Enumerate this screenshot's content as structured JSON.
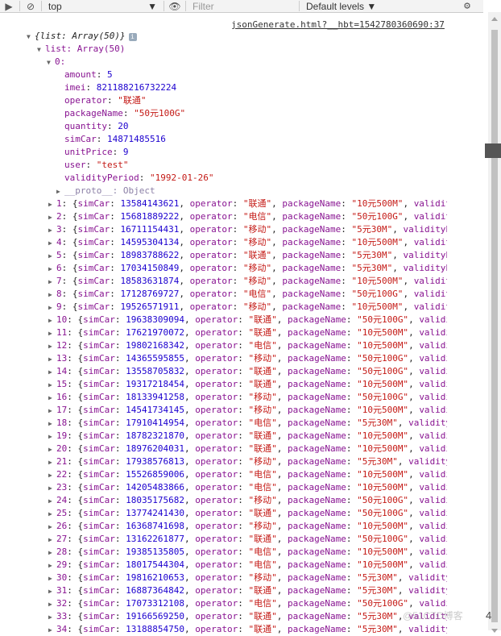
{
  "toolbar": {
    "context": "top",
    "filter_placeholder": "Filter",
    "levels": "Default levels"
  },
  "source_link": "jsonGenerate.html?__hbt=1542780360690:37",
  "root_label": "{list: Array(50)}",
  "list_label": "list: Array(50)",
  "item0": {
    "index": "0",
    "amount": "5",
    "imei": "821188216732224",
    "operator": "\"联通\"",
    "packageName": "\"50元100G\"",
    "quantity": "20",
    "simCar": "14871485516",
    "unitPrice": "9",
    "user": "\"test\"",
    "validityPeriod": "\"1992-01-26\"",
    "proto": "__proto__: Object"
  },
  "rows": [
    {
      "i": "1",
      "sim": "13584143621",
      "op": "\"联通\"",
      "pkg": "\"10元500M\""
    },
    {
      "i": "2",
      "sim": "15681889222",
      "op": "\"电信\"",
      "pkg": "\"50元100G\""
    },
    {
      "i": "3",
      "sim": "16711154431",
      "op": "\"移动\"",
      "pkg": "\"5元30M\""
    },
    {
      "i": "4",
      "sim": "14595304134",
      "op": "\"移动\"",
      "pkg": "\"10元500M\""
    },
    {
      "i": "5",
      "sim": "18983788622",
      "op": "\"联通\"",
      "pkg": "\"5元30M\""
    },
    {
      "i": "6",
      "sim": "17034150849",
      "op": "\"移动\"",
      "pkg": "\"5元30M\""
    },
    {
      "i": "7",
      "sim": "18583631874",
      "op": "\"移动\"",
      "pkg": "\"10元500M\""
    },
    {
      "i": "8",
      "sim": "17128769727",
      "op": "\"电信\"",
      "pkg": "\"50元100G\""
    },
    {
      "i": "9",
      "sim": "19526571911",
      "op": "\"移动\"",
      "pkg": "\"10元500M\""
    },
    {
      "i": "10",
      "sim": "19638309094",
      "op": "\"联通\"",
      "pkg": "\"50元100G\""
    },
    {
      "i": "11",
      "sim": "17621970072",
      "op": "\"联通\"",
      "pkg": "\"10元500M\""
    },
    {
      "i": "12",
      "sim": "19802168342",
      "op": "\"电信\"",
      "pkg": "\"10元500M\""
    },
    {
      "i": "13",
      "sim": "14365595855",
      "op": "\"移动\"",
      "pkg": "\"50元100G\""
    },
    {
      "i": "14",
      "sim": "13558705832",
      "op": "\"联通\"",
      "pkg": "\"50元100G\""
    },
    {
      "i": "15",
      "sim": "19317218454",
      "op": "\"联通\"",
      "pkg": "\"10元500M\""
    },
    {
      "i": "16",
      "sim": "18133941258",
      "op": "\"移动\"",
      "pkg": "\"50元100G\""
    },
    {
      "i": "17",
      "sim": "14541734145",
      "op": "\"移动\"",
      "pkg": "\"10元500M\""
    },
    {
      "i": "18",
      "sim": "17910414954",
      "op": "\"电信\"",
      "pkg": "\"5元30M\""
    },
    {
      "i": "19",
      "sim": "18782321870",
      "op": "\"联通\"",
      "pkg": "\"10元500M\""
    },
    {
      "i": "20",
      "sim": "18976204031",
      "op": "\"联通\"",
      "pkg": "\"10元500M\""
    },
    {
      "i": "21",
      "sim": "17938576813",
      "op": "\"移动\"",
      "pkg": "\"5元30M\""
    },
    {
      "i": "22",
      "sim": "15526859006",
      "op": "\"电信\"",
      "pkg": "\"10元500M\""
    },
    {
      "i": "23",
      "sim": "14205483866",
      "op": "\"电信\"",
      "pkg": "\"10元500M\""
    },
    {
      "i": "24",
      "sim": "18035175682",
      "op": "\"移动\"",
      "pkg": "\"50元100G\""
    },
    {
      "i": "25",
      "sim": "13774241430",
      "op": "\"联通\"",
      "pkg": "\"50元100G\""
    },
    {
      "i": "26",
      "sim": "16368741698",
      "op": "\"移动\"",
      "pkg": "\"10元500M\""
    },
    {
      "i": "27",
      "sim": "13162261877",
      "op": "\"联通\"",
      "pkg": "\"50元100G\""
    },
    {
      "i": "28",
      "sim": "19385135805",
      "op": "\"电信\"",
      "pkg": "\"10元500M\""
    },
    {
      "i": "29",
      "sim": "18017544304",
      "op": "\"电信\"",
      "pkg": "\"10元500M\""
    },
    {
      "i": "30",
      "sim": "19816210653",
      "op": "\"移动\"",
      "pkg": "\"5元30M\""
    },
    {
      "i": "31",
      "sim": "16887364842",
      "op": "\"联通\"",
      "pkg": "\"5元30M\""
    },
    {
      "i": "32",
      "sim": "17073312108",
      "op": "\"电信\"",
      "pkg": "\"50元100G\""
    },
    {
      "i": "33",
      "sim": "19166569250",
      "op": "\"联通\"",
      "pkg": "\"5元30M\""
    },
    {
      "i": "34",
      "sim": "13188854750",
      "op": "\"联通\"",
      "pkg": "\"5元30M\""
    }
  ],
  "watermark": "@51CTO博客",
  "overlay_num": "4"
}
